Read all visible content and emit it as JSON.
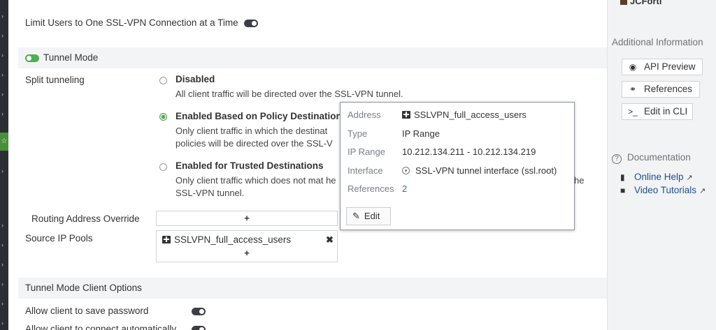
{
  "side": {
    "user_name": "JCForti",
    "additional_info_heading": "Additional Information",
    "buttons": [
      {
        "label": "API Preview",
        "icon": "eye-icon"
      },
      {
        "label": "References",
        "icon": "link-icon"
      },
      {
        "label": "Edit in CLI",
        "icon": "terminal-icon"
      }
    ],
    "documentation_heading": "Documentation",
    "links": [
      {
        "label": "Online Help",
        "icon": "book-icon"
      },
      {
        "label": "Video Tutorials",
        "icon": "video-icon"
      }
    ]
  },
  "form": {
    "limit_users_label": "Limit Users to One SSL-VPN Connection at a Time",
    "tunnel_mode_label": "Tunnel Mode",
    "split_tunneling_label": "Split tunneling",
    "options": [
      {
        "label": "Disabled",
        "desc": "All client traffic will be directed over the SSL-VPN tunnel.",
        "checked": false
      },
      {
        "label": "Enabled Based on Policy Destination",
        "desc": "Only client traffic in which the destinat policies will be directed over the SSL-V",
        "checked": true
      },
      {
        "label": "Enabled for Trusted Destinations",
        "desc": "Only client traffic which does not mat he SSL-VPN tunnel.",
        "checked": false
      }
    ],
    "routing_override_label": "Routing Address Override",
    "add_symbol": "+",
    "source_ip_pools_label": "Source IP Pools",
    "source_ip_pool_value": "SSLVPN_full_access_users",
    "remove_symbol": "✖",
    "client_options_heading": "Tunnel Mode Client Options",
    "save_password_label": "Allow client to save password",
    "auto_connect_label": "Allow client to connect automatically"
  },
  "popup": {
    "rows": [
      {
        "key": "Address",
        "value": "SSLVPN_full_access_users"
      },
      {
        "key": "Type",
        "value": "IP Range"
      },
      {
        "key": "IP Range",
        "value": "10.212.134.211 - 10.212.134.219"
      },
      {
        "key": "Interface",
        "value": "SSL-VPN tunnel interface (ssl.root)"
      },
      {
        "key": "References",
        "value": "2"
      }
    ],
    "edit_label": "Edit"
  },
  "colors": {
    "toggle_on": "#4caf50",
    "radio_checked": "#5aa857",
    "link": "#2f6db5"
  }
}
